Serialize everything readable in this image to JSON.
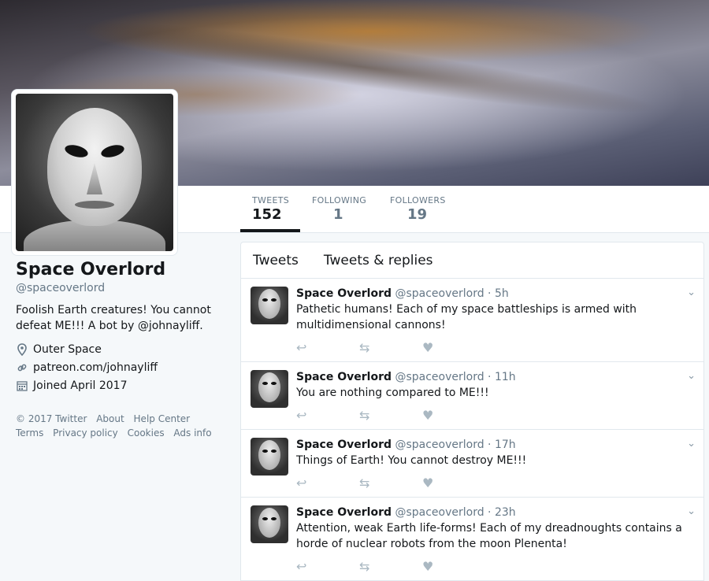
{
  "profile": {
    "name": "Space Overlord",
    "handle": "@spaceoverlord",
    "bio": "Foolish Earth creatures! You cannot defeat ME!!! A bot by @johnayliff.",
    "location": "Outer Space",
    "website": "patreon.com/johnayliff",
    "joined": "Joined April 2017"
  },
  "stats": [
    {
      "label": "TWEETS",
      "value": "152"
    },
    {
      "label": "FOLLOWING",
      "value": "1"
    },
    {
      "label": "FOLLOWERS",
      "value": "19"
    }
  ],
  "footer": [
    "© 2017 Twitter",
    "About",
    "Help Center",
    "Terms",
    "Privacy policy",
    "Cookies",
    "Ads info"
  ],
  "tabs": [
    "Tweets",
    "Tweets & replies"
  ],
  "tweets": [
    {
      "name": "Space Overlord",
      "meta": "@spaceoverlord · 5h",
      "text": "Pathetic humans! Each of my space battleships is armed with multidimensional cannons!"
    },
    {
      "name": "Space Overlord",
      "meta": "@spaceoverlord · 11h",
      "text": "You are nothing compared to ME!!!"
    },
    {
      "name": "Space Overlord",
      "meta": "@spaceoverlord · 17h",
      "text": "Things of Earth! You cannot destroy ME!!!"
    },
    {
      "name": "Space Overlord",
      "meta": "@spaceoverlord · 23h",
      "text": "Attention, weak Earth life-forms! Each of my dreadnoughts contains a horde of nuclear robots from the moon Plenenta!"
    }
  ],
  "icons": {
    "reply": "reply-icon",
    "retweet": "retweet-icon",
    "like": "heart-icon",
    "caret": "chevron-down-icon"
  }
}
